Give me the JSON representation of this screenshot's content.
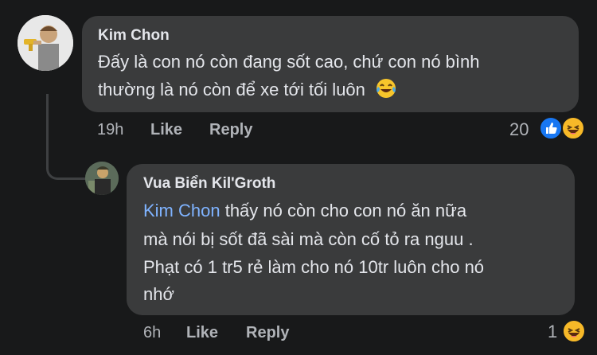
{
  "comment": {
    "author": "Kim Chon",
    "text_line1": "Đấy là con nó còn đang sốt cao, chứ con nó bình",
    "text_line2": "thường là nó còn để xe tới tối luôn",
    "emoji": "laughing-tears-emoji",
    "time": "19h",
    "like_label": "Like",
    "reply_label": "Reply",
    "reaction_count": "20",
    "reactions": [
      "like-reaction",
      "haha-reaction"
    ]
  },
  "reply": {
    "author": "Vua Biển Kil'Groth",
    "mention": "Kim Chon",
    "text_line1": " thấy nó còn cho con nó ăn nữa",
    "text_line2": "mà nói bị sốt đã sài mà còn cố tỏ ra nguu .",
    "text_line3": "Phạt có 1 tr5 rẻ làm cho nó 10tr luôn cho nó",
    "text_line4": "nhớ",
    "time": "6h",
    "like_label": "Like",
    "reply_label": "Reply",
    "reaction_count": "1",
    "reactions": [
      "haha-reaction"
    ]
  },
  "colors": {
    "background": "#18191a",
    "bubble": "#3a3b3c",
    "text": "#e4e6eb",
    "secondary_text": "#b0b3b8",
    "mention": "#7fb3ff",
    "like_blue": "#1877f2",
    "haha_yellow": "#f7b928"
  }
}
